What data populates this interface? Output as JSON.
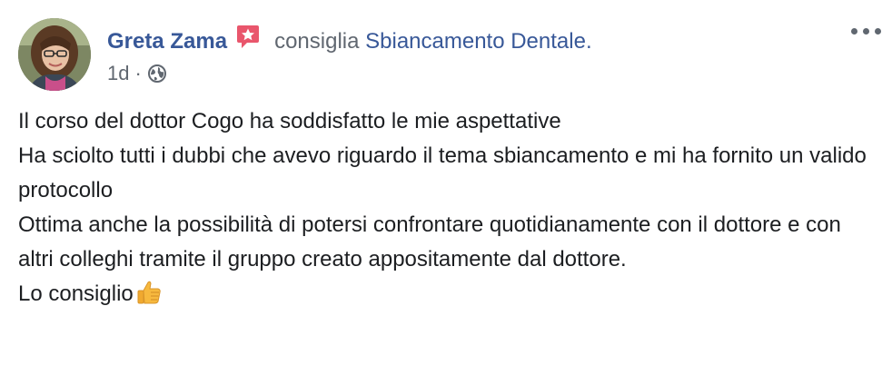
{
  "post": {
    "author": "Greta Zama",
    "action": "consiglia",
    "page_name": "Sbiancamento Dentale.",
    "timestamp": "1d",
    "separator": "·",
    "privacy_icon": "globe-icon",
    "recommend_icon": "recommend-star-icon",
    "more_icon": "more-options-icon",
    "body_lines": [
      "Il corso del dottor Cogo ha soddisfatto le mie aspettative",
      "Ha sciolto tutti i dubbi che avevo riguardo il tema sbiancamento e mi ha fornito un valido protocollo",
      "Ottima anche la possibilità di potersi confrontare quotidianamente con il dottore e con altri colleghi tramite il gruppo creato appositamente dal dottore.",
      "Lo consiglio"
    ],
    "closing_emoji": "thumbs-up-icon"
  },
  "colors": {
    "link": "#385898",
    "secondary_text": "#606770",
    "primary_text": "#1c1e21",
    "recommend_badge": "#e9566c"
  }
}
